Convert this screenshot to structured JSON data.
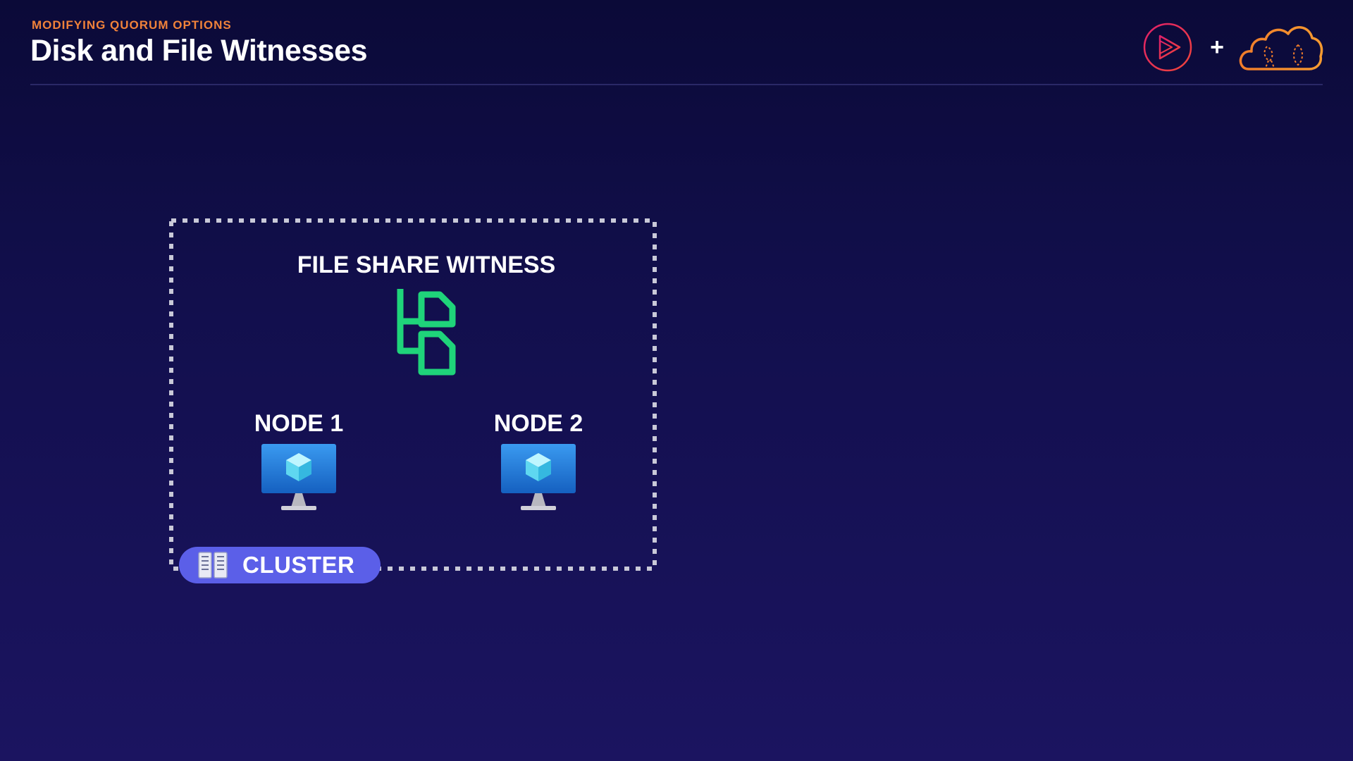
{
  "header": {
    "eyebrow": "MODIFYING QUORUM OPTIONS",
    "title": "Disk and File Witnesses",
    "plus": "+"
  },
  "logos": {
    "left": "pluralsight-play-icon",
    "right": "cloud-gurus-cloud-icon"
  },
  "diagram": {
    "witness_label": "FILE SHARE WITNESS",
    "witness_icon": "file-share-icon",
    "nodes": [
      {
        "label": "NODE 1",
        "icon": "virtual-machine-icon"
      },
      {
        "label": "NODE 2",
        "icon": "virtual-machine-icon"
      }
    ],
    "cluster_label": "CLUSTER",
    "cluster_icon": "server-rack-icon"
  },
  "colors": {
    "background_top": "#0b0a38",
    "background_bottom": "#1b1460",
    "eyebrow": "#f0823a",
    "witness_icon": "#1fd47a",
    "cluster_badge": "#5b5fe8",
    "boundary": "#c9c9d8",
    "vm_screen": "#1f78d6"
  }
}
